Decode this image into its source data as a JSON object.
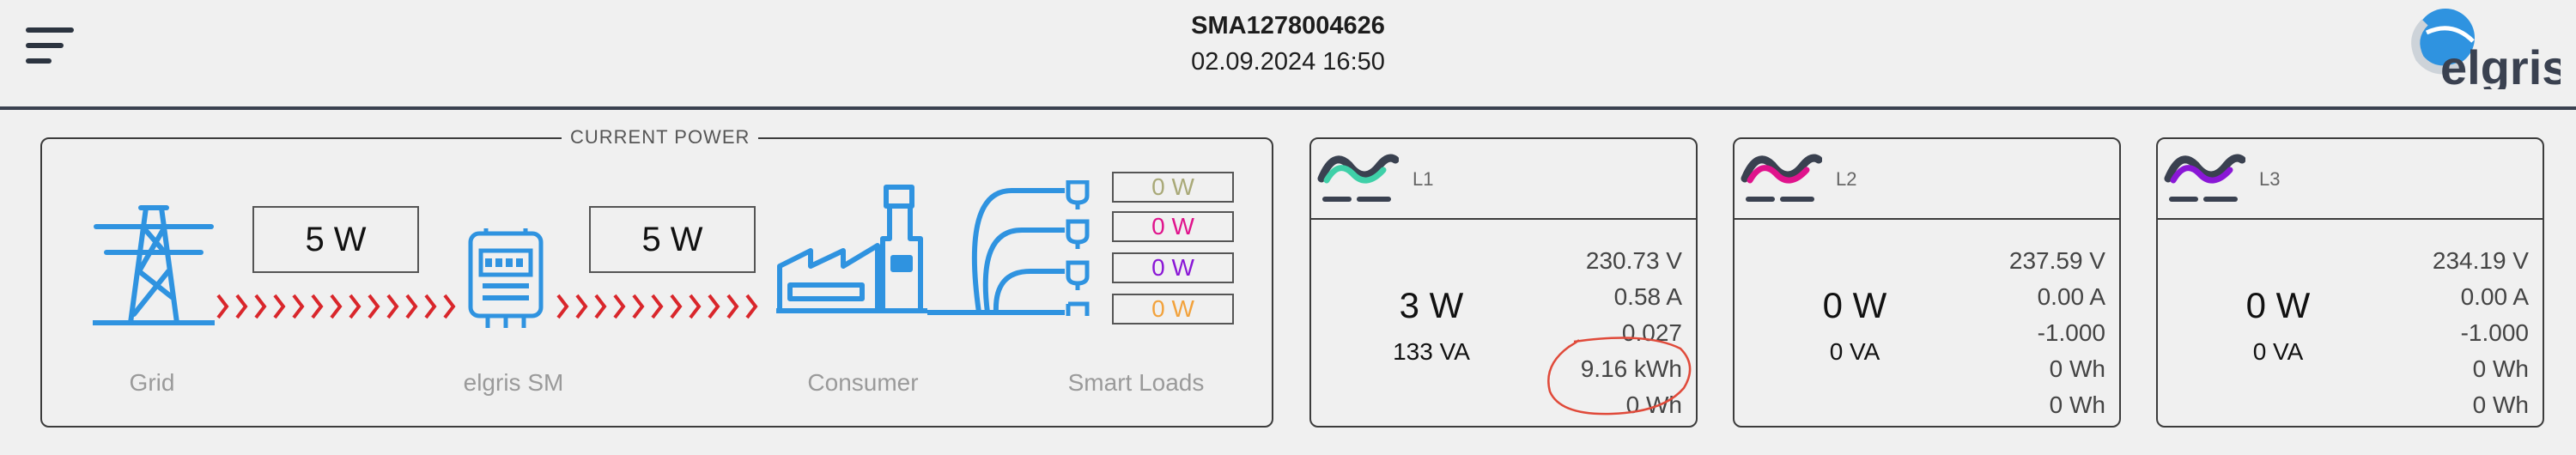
{
  "header": {
    "title": "SMA1278004626",
    "datetime": "02.09.2024 16:50",
    "logo_text": "elgris"
  },
  "current_power": {
    "legend": "CURRENT POWER",
    "grid_to_meter": "5 W",
    "meter_to_consumer": "5 W",
    "nodes": {
      "grid": "Grid",
      "meter": "elgris SM",
      "consumer": "Consumer",
      "smart_loads": "Smart Loads"
    },
    "loads": [
      {
        "value": "0 W",
        "color": "#a9a978"
      },
      {
        "value": "0 W",
        "color": "#e0138c"
      },
      {
        "value": "0 W",
        "color": "#8a17d6"
      },
      {
        "value": "0 W",
        "color": "#f2a23c"
      }
    ],
    "arrow_color": "#d9262b"
  },
  "phases": [
    {
      "name": "L1",
      "power": "3 W",
      "apparent": "133 VA",
      "voltage": "230.73 V",
      "current": "0.58 A",
      "pf": "0.027",
      "energy_in": "9.16 kWh",
      "energy_out": "0 Wh",
      "icon_accent": "#3fd0a8"
    },
    {
      "name": "L2",
      "power": "0 W",
      "apparent": "0 VA",
      "voltage": "237.59 V",
      "current": "0.00 A",
      "pf": "-1.000",
      "energy_in": "0 Wh",
      "energy_out": "0 Wh",
      "icon_accent": "#e0138c"
    },
    {
      "name": "L3",
      "power": "0 W",
      "apparent": "0 VA",
      "voltage": "234.19 V",
      "current": "0.00 A",
      "pf": "-1.000",
      "energy_in": "0 Wh",
      "energy_out": "0 Wh",
      "icon_accent": "#8a17d6"
    }
  ],
  "colors": {
    "accent": "#2f93e0",
    "annotation": "#e04a3a"
  }
}
